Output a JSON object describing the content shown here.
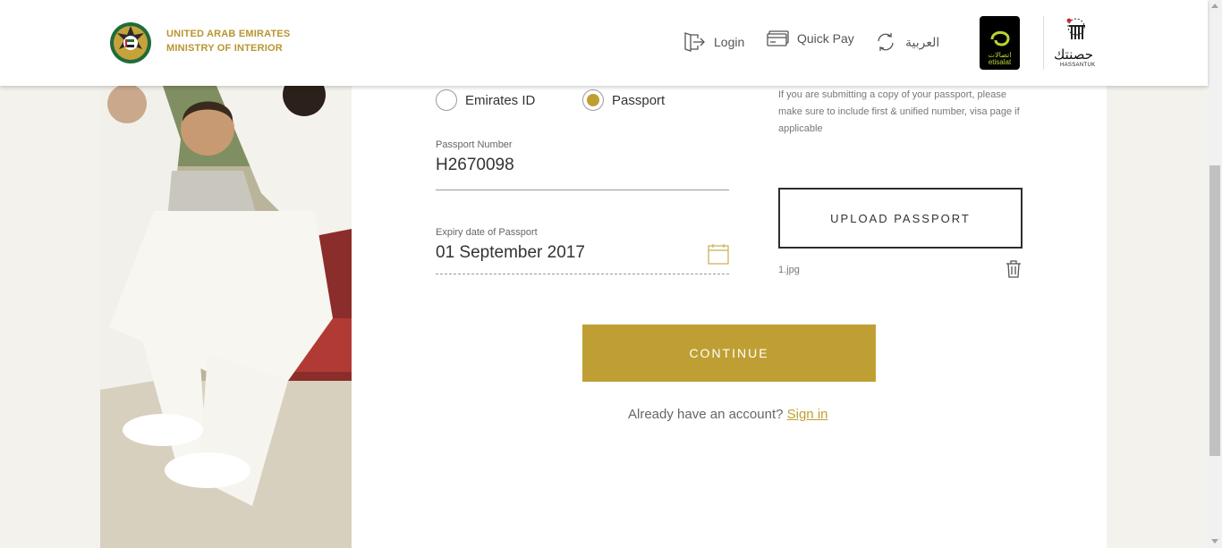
{
  "header": {
    "brand_line1": "UNITED ARAB EMIRATES",
    "brand_line2": "MINISTRY OF INTERIOR",
    "nav": {
      "login": "Login",
      "quick_pay": "Quick Pay",
      "arabic": "العربية"
    },
    "partner_etisalat_ar": "اتصالات",
    "partner_etisalat_en": "etisalat",
    "partner_hassantuk_ar": "حصنتك",
    "partner_hassantuk_en": "HASSANTUK"
  },
  "form": {
    "id_type_options": [
      "Emirates ID",
      "Passport"
    ],
    "id_type_selected": "Passport",
    "passport_number": {
      "label": "Passport Number",
      "value": "H2670098"
    },
    "expiry_date": {
      "label": "Expiry date of Passport",
      "value": "01 September 2017"
    },
    "hint": "If you are submitting a copy of your passport, please make sure to include first & unified number, visa page if applicable",
    "upload_label": "UPLOAD PASSPORT",
    "uploaded_file": "1.jpg",
    "continue_label": "CONTINUE",
    "signin_prompt": "Already have an account?",
    "signin_link": "Sign in"
  },
  "colors": {
    "accent_gold": "#bf9f33",
    "brand_gold": "#b8952f",
    "etisalat_green": "#b7d433"
  },
  "icons": [
    "login-icon",
    "card-icon",
    "language-swap-icon",
    "calendar-icon",
    "trash-icon"
  ]
}
